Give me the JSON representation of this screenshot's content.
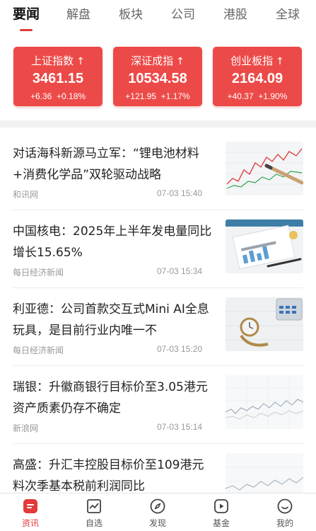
{
  "tabs": [
    {
      "label": "要闻",
      "active": true
    },
    {
      "label": "解盘",
      "active": false
    },
    {
      "label": "板块",
      "active": false
    },
    {
      "label": "公司",
      "active": false
    },
    {
      "label": "港股",
      "active": false
    },
    {
      "label": "全球",
      "active": false
    }
  ],
  "indices": [
    {
      "name": "上证指数",
      "value": "3461.15",
      "change": "+6.36",
      "percent": "+0.18%",
      "arrow": "↑"
    },
    {
      "name": "深证成指",
      "value": "10534.58",
      "change": "+121.95",
      "percent": "+1.17%",
      "arrow": "↑"
    },
    {
      "name": "创业板指",
      "value": "2164.09",
      "change": "+40.37",
      "percent": "+1.90%",
      "arrow": "↑"
    }
  ],
  "news": [
    {
      "title": "对话海科新源马立军：“锂电池材料+消费化学品”双轮驱动战略",
      "source": "和讯网",
      "time": "07-03 15:40",
      "thumb": "chart-pen-photo"
    },
    {
      "title": "中国核电：2025年上半年发电量同比增长15.65%",
      "source": "每日经济新闻",
      "time": "07-03 15:34",
      "thumb": "merchandise-chart-photo"
    },
    {
      "title": "利亚德：公司首款交互式Mini AI全息玩具，是目前行业内唯一不",
      "source": "每日经济新闻",
      "time": "07-03 15:20",
      "thumb": "calculator-watch-photo"
    },
    {
      "title": "瑞银：升徽商银行目标价至3.05港元 资产质素仍存不确定",
      "source": "新浪网",
      "time": "07-03 15:14",
      "thumb": "line-chart-image"
    },
    {
      "title": "高盛：升汇丰控股目标价至109港元 料次季基本税前利润同比",
      "source": "",
      "time": "",
      "thumb": "line-chart-image"
    }
  ],
  "bottom_nav": [
    {
      "label": "资讯",
      "icon": "news-icon",
      "active": true
    },
    {
      "label": "自选",
      "icon": "chart-trend-icon",
      "active": false
    },
    {
      "label": "发现",
      "icon": "compass-icon",
      "active": false
    },
    {
      "label": "基金",
      "icon": "play-circle-icon",
      "active": false
    },
    {
      "label": "我的",
      "icon": "smiley-icon",
      "active": false
    }
  ],
  "colors": {
    "accent": "#e23b3b",
    "card": "#ec4a48",
    "muted": "#999999"
  }
}
